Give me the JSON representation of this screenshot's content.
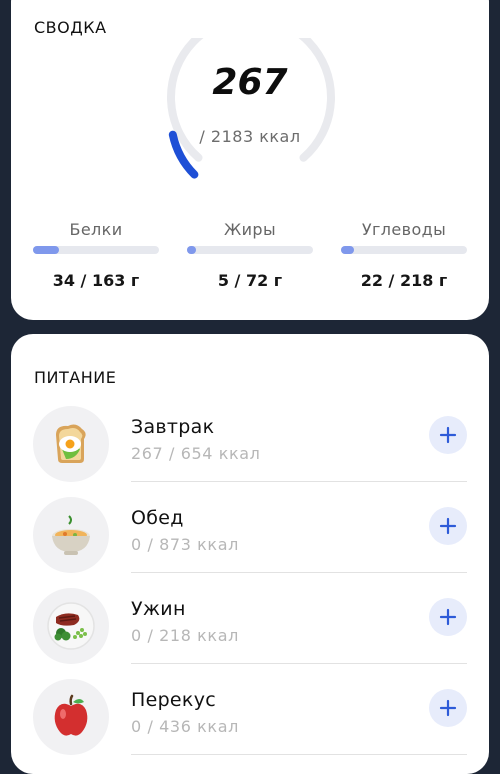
{
  "summary": {
    "title": "СВОДКА",
    "calories_eaten": "267",
    "calories_goal": "/ 2183 ккал",
    "calories_progress": 0.122,
    "macros": [
      {
        "label": "Белки",
        "value": "34 / 163 г",
        "progress": 0.21
      },
      {
        "label": "Жиры",
        "value": "5 / 72 г",
        "progress": 0.07
      },
      {
        "label": "Углеводы",
        "value": "22 / 218 г",
        "progress": 0.1
      }
    ]
  },
  "nutrition": {
    "title": "ПИТАНИЕ",
    "meals": [
      {
        "name": "Завтрак",
        "calories": "267 / 654 ккал",
        "icon": "breakfast-toast-egg-icon"
      },
      {
        "name": "Обед",
        "calories": "0 / 873 ккал",
        "icon": "lunch-soup-bowl-icon"
      },
      {
        "name": "Ужин",
        "calories": "0 / 218 ккал",
        "icon": "dinner-steak-plate-icon"
      },
      {
        "name": "Перекус",
        "calories": "0 / 436 ккал",
        "icon": "snack-apple-icon"
      }
    ]
  },
  "colors": {
    "background": "#1d2636",
    "gauge_track": "#e9eaee",
    "gauge_fill": "#1e4fd6",
    "macro_fill": "#7f98ec",
    "add_button_bg": "#e7ecfb",
    "add_button_fg": "#2e5bd8"
  }
}
